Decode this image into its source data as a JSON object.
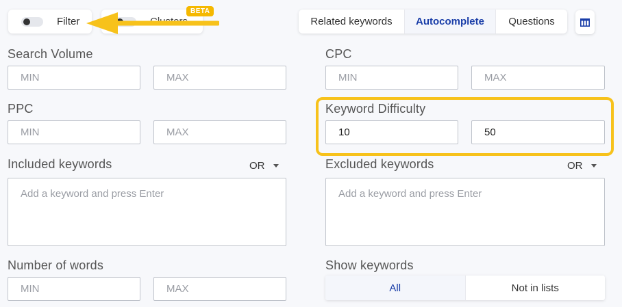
{
  "toolbar": {
    "filter_label": "Filter",
    "clusters_label": "Clusters",
    "beta_badge": "BETA",
    "tabs": [
      {
        "label": "Related keywords",
        "active": false
      },
      {
        "label": "Autocomplete",
        "active": true
      },
      {
        "label": "Questions",
        "active": false
      }
    ],
    "columns_icon": "columns-icon"
  },
  "filters": {
    "search_volume": {
      "label": "Search Volume",
      "min_placeholder": "MIN",
      "max_placeholder": "MAX"
    },
    "cpc": {
      "label": "CPC",
      "min_placeholder": "MIN",
      "max_placeholder": "MAX"
    },
    "ppc": {
      "label": "PPC",
      "min_placeholder": "MIN",
      "max_placeholder": "MAX"
    },
    "keyword_difficulty": {
      "label": "Keyword Difficulty",
      "min_value": "10",
      "max_value": "50"
    },
    "included_keywords": {
      "label": "Included keywords",
      "operator": "OR",
      "placeholder": "Add a keyword and press Enter"
    },
    "excluded_keywords": {
      "label": "Excluded keywords",
      "operator": "OR",
      "placeholder": "Add a keyword and press Enter"
    },
    "number_of_words": {
      "label": "Number of words",
      "min_placeholder": "MIN",
      "max_placeholder": "MAX"
    },
    "show_keywords": {
      "label": "Show keywords",
      "options": [
        "All",
        "Not in lists"
      ],
      "selected": "All"
    }
  },
  "colors": {
    "accent": "#1a3ea8",
    "highlight": "#f7c21b",
    "badge": "#f5b800"
  }
}
